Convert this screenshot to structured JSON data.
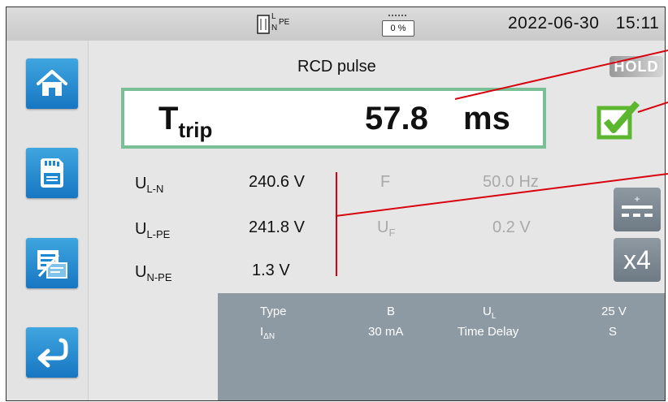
{
  "status": {
    "wiring_label_l": "L",
    "wiring_label_n": "N",
    "wiring_label_pe": "PE",
    "battery_percent": "0 %",
    "date": "2022-06-30",
    "time": "15:11"
  },
  "sidebar": {
    "items": [
      {
        "icon": "home-icon"
      },
      {
        "icon": "sd-card-icon"
      },
      {
        "icon": "report-icon"
      },
      {
        "icon": "back-icon"
      }
    ]
  },
  "main": {
    "title": "RCD pulse",
    "hold": "HOLD",
    "result": {
      "label_main": "T",
      "label_sub": "trip",
      "value": "57.8",
      "unit": "ms",
      "status_icon": "check-pass-icon",
      "status_color": "#5cb630"
    },
    "voltages": [
      {
        "main": "U",
        "sub": "L-N",
        "value": "240.6 V"
      },
      {
        "main": "U",
        "sub": "L-PE",
        "value": "241.8 V"
      },
      {
        "main": "U",
        "sub": "N-PE",
        "value": "1.3 V"
      }
    ],
    "frequency": {
      "label": "F",
      "value": "50.0 Hz"
    },
    "fault_voltage": {
      "main": "U",
      "sub": "F",
      "value": "0.2 V"
    },
    "side_buttons": {
      "polarity_icon": "dc-polarity-icon",
      "multiplier": "x4"
    },
    "params": {
      "type_label": "Type",
      "type_value": "B",
      "ul_main": "U",
      "ul_sub": "L",
      "ul_value": "25 V",
      "idn_main": "I",
      "idn_sub": "ΔN",
      "idn_value": "30 mA",
      "delay_label": "Time Delay",
      "delay_value": "S"
    }
  },
  "colors": {
    "accent_blue": "#1e88d0",
    "result_border": "#7bbf96",
    "callout_red": "#d9000e",
    "panel_grey": "#8e9aa3"
  }
}
